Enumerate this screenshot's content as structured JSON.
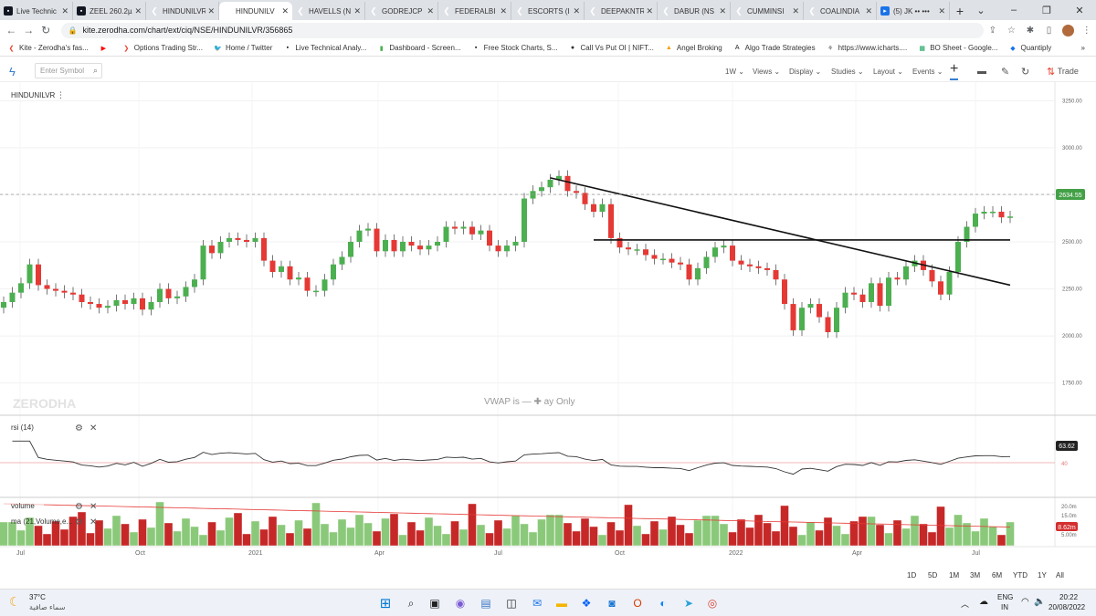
{
  "browser": {
    "tabs": [
      {
        "label": "Live Technic",
        "icon": "tv-icon"
      },
      {
        "label": "ZEEL 260.2µ",
        "icon": "tv-icon"
      },
      {
        "label": "HINDUNILVR",
        "icon": "kite-icon"
      },
      {
        "label": "HINDUNILV",
        "icon": "kite-icon",
        "active": true
      },
      {
        "label": "HAVELLS (N",
        "icon": "kite-icon"
      },
      {
        "label": "GODREJCP",
        "icon": "kite-icon"
      },
      {
        "label": "FEDERALBI",
        "icon": "kite-icon"
      },
      {
        "label": "ESCORTS (I",
        "icon": "kite-icon"
      },
      {
        "label": "DEEPAKNTR",
        "icon": "kite-icon"
      },
      {
        "label": "DABUR (NS",
        "icon": "kite-icon"
      },
      {
        "label": "CUMMINSI",
        "icon": "kite-icon"
      },
      {
        "label": "COALINDIA",
        "icon": "kite-icon"
      },
      {
        "label": "(5) JK •• •••",
        "icon": "youtube-icon"
      }
    ],
    "url": "kite.zerodha.com/chart/ext/ciq/NSE/HINDUNILVR/356865",
    "bookmarks": [
      "Kite - Zerodha's fas...",
      "",
      "Options Trading Str...",
      "Home / Twitter",
      "Live Technical Analy...",
      "Dashboard - Screen...",
      "Free Stock Charts, S...",
      "Call Vs Put OI | NIFT...",
      "Angel Broking",
      "Algo Trade Strategies",
      "https://www.icharts....",
      "BO Sheet - Google...",
      "Quantiply"
    ]
  },
  "toolbar": {
    "symbol_placeholder": "Enter Symbol",
    "interval": "1W",
    "views": "Views",
    "display": "Display",
    "studies": "Studies",
    "layout": "Layout",
    "events": "Events",
    "trade": "Trade"
  },
  "chart": {
    "symbol": "HINDUNILVR",
    "watermark": "ZERODHA",
    "vwap_note": "VWAP is — ✚ ay Only",
    "price_label": "2634.55",
    "rsi_label": "rsi (14)",
    "rsi_value": "63.62",
    "rsi_level_40": "40",
    "volume_label": "volume",
    "ma_label": "ma (21,Volume,e...",
    "volume_value": "8.62m",
    "volume_ticks": [
      "20.0m",
      "15.0m",
      "5.00m"
    ]
  },
  "chart_data": {
    "type": "candlestick",
    "x_tick_labels": [
      "Jul",
      "Oct",
      "2021",
      "Apr",
      "Jul",
      "Oct",
      "2022",
      "Apr",
      "Jul"
    ],
    "y_tick_labels": [
      "3250.00",
      "3000.00",
      "2750.00",
      "2500.00",
      "2250.00",
      "2000.00",
      "1750.00"
    ],
    "ylim": [
      1700,
      3300
    ],
    "last_price": 2634.55,
    "closes": [
      2180,
      2230,
      2280,
      2380,
      2270,
      2250,
      2240,
      2230,
      2220,
      2180,
      2170,
      2150,
      2160,
      2190,
      2170,
      2200,
      2140,
      2180,
      2250,
      2200,
      2210,
      2260,
      2300,
      2480,
      2440,
      2500,
      2520,
      2510,
      2500,
      2520,
      2400,
      2340,
      2370,
      2300,
      2310,
      2240,
      2240,
      2300,
      2380,
      2420,
      2500,
      2560,
      2570,
      2450,
      2510,
      2450,
      2500,
      2480,
      2460,
      2480,
      2500,
      2580,
      2570,
      2580,
      2540,
      2560,
      2480,
      2450,
      2480,
      2500,
      2730,
      2770,
      2790,
      2830,
      2850,
      2770,
      2760,
      2700,
      2660,
      2700,
      2520,
      2470,
      2460,
      2460,
      2430,
      2410,
      2410,
      2390,
      2380,
      2300,
      2360,
      2420,
      2470,
      2480,
      2400,
      2380,
      2370,
      2360,
      2350,
      2300,
      2170,
      2030,
      2150,
      2170,
      2100,
      2020,
      2150,
      2230,
      2220,
      2180,
      2280,
      2160,
      2310,
      2300,
      2370,
      2400,
      2350,
      2290,
      2220,
      2340,
      2500,
      2580,
      2650,
      2660,
      2660,
      2630,
      2634.55
    ],
    "trendlines": [
      {
        "from": [
          63,
          2840
        ],
        "to": [
          116,
          2270
        ]
      },
      {
        "from": [
          68,
          2510
        ],
        "to": [
          116,
          2510
        ]
      }
    ],
    "rsi": {
      "ylim": [
        20,
        80
      ],
      "level": 40
    },
    "volume": {
      "ticks": [
        "20.0m",
        "15.0m",
        "5.00m"
      ]
    }
  },
  "rangebar": [
    "1D",
    "5D",
    "1M",
    "3M",
    "6M",
    "YTD",
    "1Y",
    "All"
  ],
  "taskbar": {
    "weather_temp": "37°C",
    "weather_desc": "سماء صافية",
    "lang1": "ENG",
    "lang2": "IN",
    "time": "20:22",
    "date": "20/08/2022"
  }
}
